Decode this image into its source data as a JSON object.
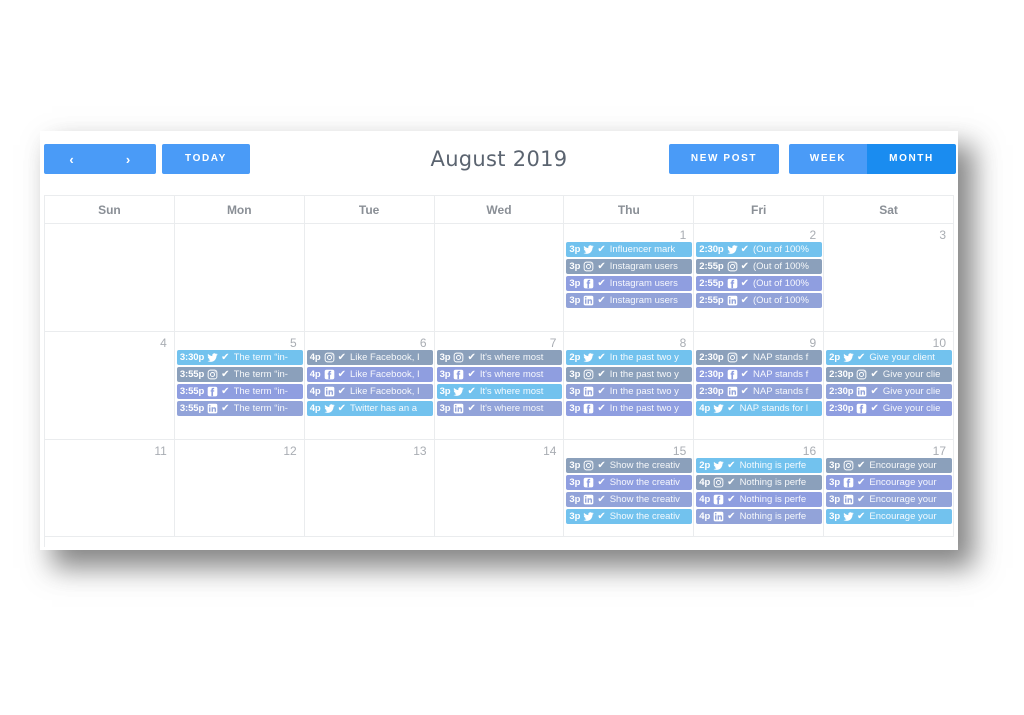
{
  "toolbar": {
    "prev_label": "‹",
    "next_label": "›",
    "today_label": "TODAY",
    "title": "August 2019",
    "new_post_label": "NEW POST",
    "week_label": "WEEK",
    "month_label": "MONTH",
    "active_view": "MONTH",
    "colors": {
      "accent": "#4a9bf7",
      "accent_active": "#1a8cf0",
      "title_text": "#5b6470"
    }
  },
  "calendar": {
    "day_names": [
      "Sun",
      "Mon",
      "Tue",
      "Wed",
      "Thu",
      "Fri",
      "Sat"
    ],
    "platform_colors": {
      "twitter": "#72c2ee",
      "instagram": "#8ba0bb",
      "facebook": "#8f9ee0",
      "linkedin": "#92a3d9"
    },
    "check_glyph": "✔",
    "weeks": [
      {
        "days": [
          {
            "num": "",
            "events": []
          },
          {
            "num": "",
            "events": []
          },
          {
            "num": "",
            "events": []
          },
          {
            "num": "",
            "events": []
          },
          {
            "num": "1",
            "events": [
              {
                "time": "3p",
                "platform": "twitter",
                "title": "Influencer mark"
              },
              {
                "time": "3p",
                "platform": "instagram",
                "title": "Instagram users"
              },
              {
                "time": "3p",
                "platform": "facebook",
                "title": "Instagram users"
              },
              {
                "time": "3p",
                "platform": "linkedin",
                "title": "Instagram users"
              }
            ]
          },
          {
            "num": "2",
            "events": [
              {
                "time": "2:30p",
                "platform": "twitter",
                "title": "(Out of 100%"
              },
              {
                "time": "2:55p",
                "platform": "instagram",
                "title": "(Out of 100%"
              },
              {
                "time": "2:55p",
                "platform": "facebook",
                "title": "(Out of 100%"
              },
              {
                "time": "2:55p",
                "platform": "linkedin",
                "title": "(Out of 100%"
              }
            ]
          },
          {
            "num": "3",
            "events": []
          }
        ]
      },
      {
        "days": [
          {
            "num": "4",
            "events": []
          },
          {
            "num": "5",
            "events": [
              {
                "time": "3:30p",
                "platform": "twitter",
                "title": "The term “in-"
              },
              {
                "time": "3:55p",
                "platform": "instagram",
                "title": "The term “in-"
              },
              {
                "time": "3:55p",
                "platform": "facebook",
                "title": "The term “in-"
              },
              {
                "time": "3:55p",
                "platform": "linkedin",
                "title": "The term “in-"
              }
            ]
          },
          {
            "num": "6",
            "events": [
              {
                "time": "4p",
                "platform": "instagram",
                "title": "Like Facebook, I"
              },
              {
                "time": "4p",
                "platform": "facebook",
                "title": "Like Facebook, I"
              },
              {
                "time": "4p",
                "platform": "linkedin",
                "title": "Like Facebook, I"
              },
              {
                "time": "4p",
                "platform": "twitter",
                "title": "Twitter has an a"
              }
            ]
          },
          {
            "num": "7",
            "events": [
              {
                "time": "3p",
                "platform": "instagram",
                "title": "It's where most"
              },
              {
                "time": "3p",
                "platform": "facebook",
                "title": "It's where most"
              },
              {
                "time": "3p",
                "platform": "twitter",
                "title": "It's where most"
              },
              {
                "time": "3p",
                "platform": "linkedin",
                "title": "It's where most"
              }
            ]
          },
          {
            "num": "8",
            "events": [
              {
                "time": "2p",
                "platform": "twitter",
                "title": "In the past two y"
              },
              {
                "time": "3p",
                "platform": "instagram",
                "title": "In the past two y"
              },
              {
                "time": "3p",
                "platform": "linkedin",
                "title": "In the past two y"
              },
              {
                "time": "3p",
                "platform": "facebook",
                "title": "In the past two y"
              }
            ]
          },
          {
            "num": "9",
            "events": [
              {
                "time": "2:30p",
                "platform": "instagram",
                "title": "NAP stands f"
              },
              {
                "time": "2:30p",
                "platform": "facebook",
                "title": "NAP stands f"
              },
              {
                "time": "2:30p",
                "platform": "linkedin",
                "title": "NAP stands f"
              },
              {
                "time": "4p",
                "platform": "twitter",
                "title": "NAP stands for l"
              }
            ]
          },
          {
            "num": "10",
            "events": [
              {
                "time": "2p",
                "platform": "twitter",
                "title": "Give your client"
              },
              {
                "time": "2:30p",
                "platform": "instagram",
                "title": "Give your clie"
              },
              {
                "time": "2:30p",
                "platform": "linkedin",
                "title": "Give your clie"
              },
              {
                "time": "2:30p",
                "platform": "facebook",
                "title": "Give your clie"
              }
            ]
          }
        ]
      },
      {
        "days": [
          {
            "num": "11",
            "events": []
          },
          {
            "num": "12",
            "events": []
          },
          {
            "num": "13",
            "events": []
          },
          {
            "num": "14",
            "events": []
          },
          {
            "num": "15",
            "events": [
              {
                "time": "3p",
                "platform": "instagram",
                "title": "Show the creativ"
              },
              {
                "time": "3p",
                "platform": "facebook",
                "title": "Show the creativ"
              },
              {
                "time": "3p",
                "platform": "linkedin",
                "title": "Show the creativ"
              },
              {
                "time": "3p",
                "platform": "twitter",
                "title": "Show the creativ"
              }
            ]
          },
          {
            "num": "16",
            "events": [
              {
                "time": "2p",
                "platform": "twitter",
                "title": "Nothing is perfe"
              },
              {
                "time": "4p",
                "platform": "instagram",
                "title": "Nothing is perfe"
              },
              {
                "time": "4p",
                "platform": "facebook",
                "title": "Nothing is perfe"
              },
              {
                "time": "4p",
                "platform": "linkedin",
                "title": "Nothing is perfe"
              }
            ]
          },
          {
            "num": "17",
            "events": [
              {
                "time": "3p",
                "platform": "instagram",
                "title": "Encourage your"
              },
              {
                "time": "3p",
                "platform": "facebook",
                "title": "Encourage your"
              },
              {
                "time": "3p",
                "platform": "linkedin",
                "title": "Encourage your"
              },
              {
                "time": "3p",
                "platform": "twitter",
                "title": "Encourage your"
              }
            ]
          }
        ]
      }
    ]
  }
}
